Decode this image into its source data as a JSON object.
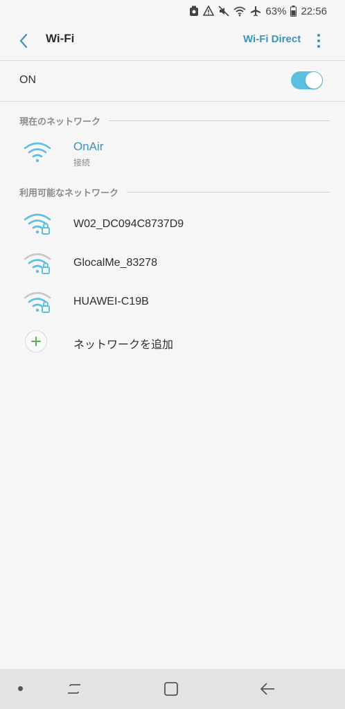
{
  "status_bar": {
    "battery_percent": "63%",
    "time": "22:56",
    "icons": [
      "recorder-icon",
      "signal-alert-icon",
      "mute-icon",
      "wifi-icon",
      "airplane-icon",
      "battery-icon"
    ]
  },
  "app_bar": {
    "title": "Wi-Fi",
    "wifi_direct_label": "Wi-Fi Direct"
  },
  "toggle": {
    "label": "ON",
    "state": "on",
    "accent_color": "#5bbfe0"
  },
  "current_network": {
    "header": "現在のネットワーク",
    "name": "OnAir",
    "status": "接続"
  },
  "available_networks": {
    "header": "利用可能なネットワーク",
    "items": [
      {
        "name": "W02_DC094C8737D9",
        "secured": true
      },
      {
        "name": "GlocalMe_83278",
        "secured": true
      },
      {
        "name": "HUAWEI-C19B",
        "secured": true
      }
    ]
  },
  "add_network": {
    "label": "ネットワークを追加"
  },
  "colors": {
    "accent": "#3a93ba",
    "add_plus": "#4cb64c"
  }
}
